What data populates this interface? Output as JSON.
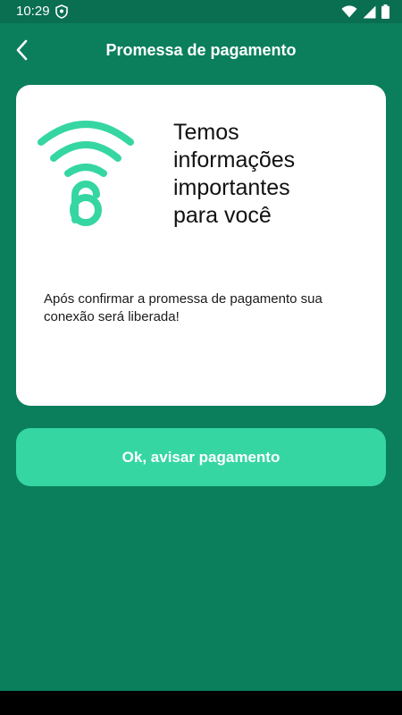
{
  "status_bar": {
    "time": "10:29",
    "icons": [
      "shield-icon",
      "wifi-icon",
      "signal-icon",
      "battery-icon"
    ]
  },
  "app_bar": {
    "title": "Promessa de pagamento",
    "back_icon": "chevron-left-icon"
  },
  "card": {
    "icon": "wifi-lock-icon",
    "heading": "Temos\n informações\n importantes\n para você",
    "message": "Após confirmar a promessa de pagamento sua conexão será liberada!"
  },
  "actions": {
    "confirm_label": "Ok, avisar pagamento"
  },
  "colors": {
    "background": "#0b7f5c",
    "status_bar": "#0a6e50",
    "accent": "#35d6a2",
    "card": "#ffffff"
  }
}
